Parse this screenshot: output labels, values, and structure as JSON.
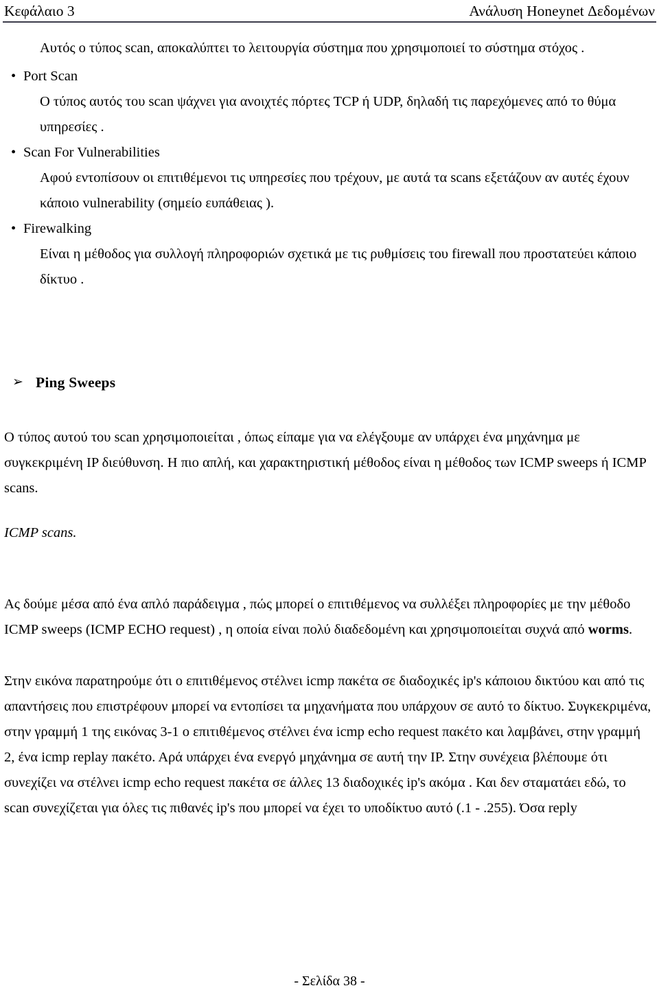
{
  "header": {
    "left": "Κεφάλαιο 3",
    "right": "Ανάλυση Honeynet Δεδομένων"
  },
  "intro": {
    "text": "Αυτός ο τύπος  scan,  αποκαλύπτει το λειτουργία σύστημα που χρησιμοποιεί το σύστημα στόχος ."
  },
  "bullets": [
    {
      "label": "Port Scan",
      "bullet_glyph": "•",
      "body": "Ο τύπος αυτός του scan  ψάχνει για ανοιχτές πόρτες TCP ή UDP, δηλαδή   τις παρεχόμενες από το θύμα υπηρεσίες ."
    },
    {
      "label": "Scan For Vulnerabilities",
      "bullet_glyph": "•",
      "body": "Αφού  εντοπίσουν οι επιτιθέμενοι τις υπηρεσίες που τρέχουν,  με αυτά τα scans  εξετάζουν αν αυτές  έχουν κάποιο  vulnerability (σημείο ευπάθειας )."
    },
    {
      "label": "Firewalking",
      "bullet_glyph": "•",
      "body": "Είναι η μέθοδος για συλλογή πληροφοριών σχετικά με τις ρυθμίσεις του firewall  που προστατεύει κάποιο δίκτυο ."
    }
  ],
  "section": {
    "arrow_glyph": "➢",
    "heading": "Ping Sweeps",
    "paragraph1": "Ο τύπος αυτού του scan  χρησιμοποιείται , όπως είπαμε για να ελέγξουμε  αν υπάρχει ένα μηχάνημα με συγκεκριμένη IP διεύθυνση. Η πιο απλή, και χαρακτηριστική  μέθοδος είναι η μέθοδος των ICMP sweeps ή ICMP scans.",
    "subheading_italic": "ICMP scans.",
    "paragraph2_part1": " Ας δούμε μέσα  από ένα απλό παράδειγμα , πώς μπορεί ο επιτιθέμενος να συλλέξει πληροφορίες με την μέθοδο ICMP sweeps (ICMP ECHO request) ,  η οποία είναι πολύ διαδεδομένη και χρησιμοποιείται συχνά από ",
    "paragraph2_bold": "worms",
    "paragraph2_part2": ".",
    "paragraph3": "Στην εικόνα  παρατηρούμε  ότι ο επιτιθέμενος στέλνει icmp πακέτα  σε  διαδοχικές  ip's  κάποιου δικτύου  και από τις απαντήσεις  που επιστρέφουν μπορεί να εντοπίσει τα μηχανήματα που υπάρχουν σε αυτό το δίκτυο. Συγκεκριμένα, στην γραμμή 1 της εικόνας 3-1  ο επιτιθέμενος στέλνει ένα icmp echo request πακέτο και λαμβάνει, στην γραμμή 2, ένα icmp replay πακέτο. Αρά υπάρχει ένα ενεργό μηχάνημα σε αυτή την IP. Στην συνέχεια βλέπουμε  ότι  συνεχίζει να στέλνει  icmp echo request πακέτα σε άλλες 13 διαδοχικές ip's ακόμα . Και δεν σταματάει  εδώ, το scan συνεχίζεται για όλες τις πιθανές ip's που μπορεί να έχει το υποδίκτυο  αυτό  (.1 - .255). Όσα  reply"
  },
  "footer": {
    "page_label": "- Σελίδα 38 -"
  },
  "colors": {
    "text": "#000000",
    "rule": "#3c3c4a",
    "background": "#ffffff"
  }
}
